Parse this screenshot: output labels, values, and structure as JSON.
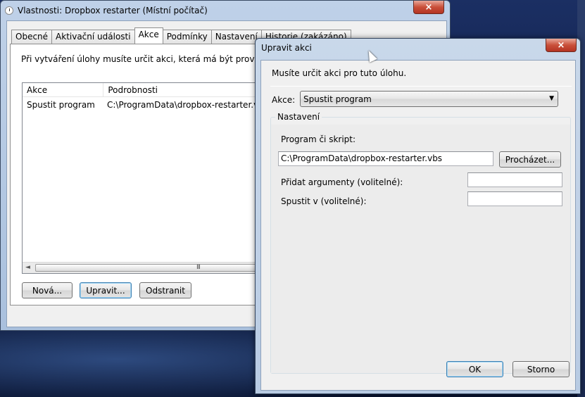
{
  "main_window": {
    "title": "Vlastnosti: Dropbox restarter (Místní počítač)",
    "tabs": [
      {
        "label": "Obecné"
      },
      {
        "label": "Aktivační události"
      },
      {
        "label": "Akce"
      },
      {
        "label": "Podmínky"
      },
      {
        "label": "Nastavení"
      },
      {
        "label": "Historie (zakázáno)"
      }
    ],
    "active_tab": "Akce",
    "instruction": "Při vytváření úlohy musíte určit akci, která má být provedena p",
    "list": {
      "columns": [
        "Akce",
        "Podrobnosti"
      ],
      "rows": [
        {
          "akce": "Spustit program",
          "podrobnosti": "C:\\ProgramData\\dropbox-restarter.vbs"
        }
      ]
    },
    "buttons": {
      "new": "Nová...",
      "edit": "Upravit...",
      "delete": "Odstranit"
    }
  },
  "dialog": {
    "title": "Upravit akci",
    "instruction": "Musíte určit akci pro tuto úlohu.",
    "action_label": "Akce:",
    "action_value": "Spustit program",
    "group_title": "Nastavení",
    "program_label": "Program či skript:",
    "program_value": "C:\\ProgramData\\dropbox-restarter.vbs",
    "browse_button": "Procházet...",
    "args_label": "Přidat argumenty (volitelné):",
    "args_value": "",
    "start_in_label": "Spustit v (volitelné):",
    "start_in_value": "",
    "ok_button": "OK",
    "cancel_button": "Storno"
  },
  "icons": {
    "close": "×",
    "combo_arrow": "▼",
    "scroll_left": "◄",
    "scroll_grip": "III"
  },
  "colors": {
    "accent": "#3c7fb1",
    "close_red": "#c9503a"
  }
}
